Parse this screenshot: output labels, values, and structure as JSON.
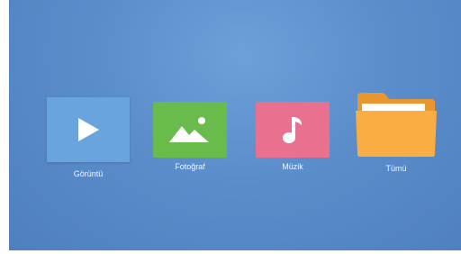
{
  "tiles": {
    "video": {
      "label": "Görüntü",
      "icon": "play-icon",
      "color": "#6aa4dd"
    },
    "photo": {
      "label": "Fotoğraf",
      "icon": "image-icon",
      "color": "#69bb4b"
    },
    "music": {
      "label": "Müzik",
      "icon": "music-note-icon",
      "color": "#e9708f"
    },
    "all": {
      "label": "Tümü",
      "icon": "folder-icon",
      "color": "#f7a83a"
    }
  }
}
